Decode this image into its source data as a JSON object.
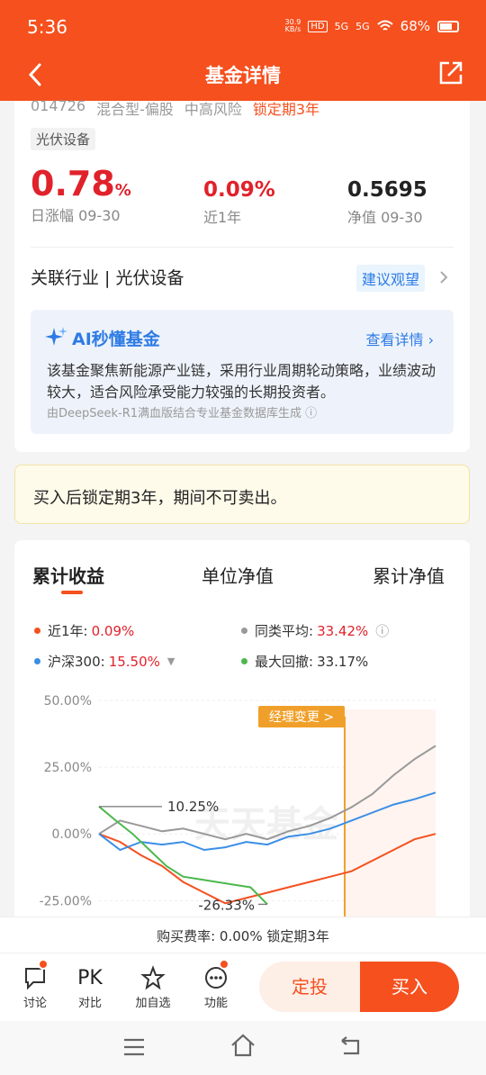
{
  "status": {
    "time": "5:36",
    "speed_top": "30.9",
    "speed_bottom": "KB/s",
    "hd": "HD",
    "net1": "5G",
    "net2": "5G",
    "battery": "68%"
  },
  "header": {
    "title": "基金详情"
  },
  "fund": {
    "code": "014726",
    "category": "混合型-偏股",
    "risk": "中高风险",
    "lock": "锁定期3年",
    "tag": "光伏设备",
    "daily_value": "0.78",
    "daily_unit": "%",
    "daily_label": "日涨幅 09-30",
    "year_value": "0.09%",
    "year_label": "近1年",
    "nav_value": "0.5695",
    "nav_label": "净值 09-30",
    "industry": "关联行业 | 光伏设备",
    "suggest": "建议观望"
  },
  "ai": {
    "title": "AI秒懂基金",
    "detail": "查看详情",
    "text": "该基金聚焦新能源产业链，采用行业周期轮动策略，业绩波动较大，适合风险承受能力较强的长期投资者。",
    "source": "由DeepSeek-R1满血版结合专业基金数据库生成"
  },
  "notice": "买入后锁定期3年，期间不可卖出。",
  "tabs": [
    "累计收益",
    "单位净值",
    "累计净值"
  ],
  "legend": {
    "fund_label": "近1年:",
    "fund_value": "0.09%",
    "peer_label": "同类平均:",
    "peer_value": "33.42%",
    "index_label": "沪深300:",
    "index_value": "15.50%",
    "drawdown_label": "最大回撤:",
    "drawdown_value": "33.17%"
  },
  "colors": {
    "brand": "#f5501e",
    "fund": "#f5501e",
    "peer": "#999999",
    "index": "#3a8ee6",
    "drawdown": "#4cb84c",
    "manager": "#f0a02a"
  },
  "chart_data": {
    "type": "line",
    "y_ticks": [
      "50.00%",
      "25.00%",
      "0.00%",
      "-25.00%"
    ],
    "ylim": [
      -35,
      50
    ],
    "annotations": {
      "high": "10.25%",
      "low": "-26.33%",
      "manager_change": "经理变更 >"
    },
    "series": [
      {
        "name": "近1年",
        "values": [
          0,
          -3,
          -8,
          -12,
          -18,
          -22,
          -26,
          -24,
          -22,
          -20,
          -18,
          -16,
          -14,
          -10,
          -6,
          -2,
          0
        ]
      },
      {
        "name": "同类平均",
        "values": [
          0,
          5,
          3,
          1,
          2,
          0,
          -2,
          0,
          -2,
          1,
          3,
          6,
          10,
          15,
          22,
          28,
          33
        ]
      },
      {
        "name": "沪深300",
        "values": [
          0,
          -6,
          -3,
          -4,
          -3,
          -6,
          -5,
          -3,
          -4,
          -1,
          0,
          2,
          5,
          8,
          11,
          13,
          15.5
        ]
      },
      {
        "name": "最大回撤",
        "values": [
          10.25,
          5,
          0,
          -6,
          -12,
          -16,
          -17,
          -18,
          -19,
          -20,
          -26.33
        ]
      }
    ]
  },
  "watermark": "天天基金",
  "fee": "购买费率: 0.00% 锁定期3年",
  "actions": [
    {
      "label": "讨论",
      "icon": "chat-icon"
    },
    {
      "label": "对比",
      "icon": "pk-icon",
      "glyph": "PK"
    },
    {
      "label": "加自选",
      "icon": "star-icon"
    },
    {
      "label": "功能",
      "icon": "more-icon"
    }
  ],
  "buttons": {
    "dingtou": "定投",
    "buy": "买入"
  }
}
